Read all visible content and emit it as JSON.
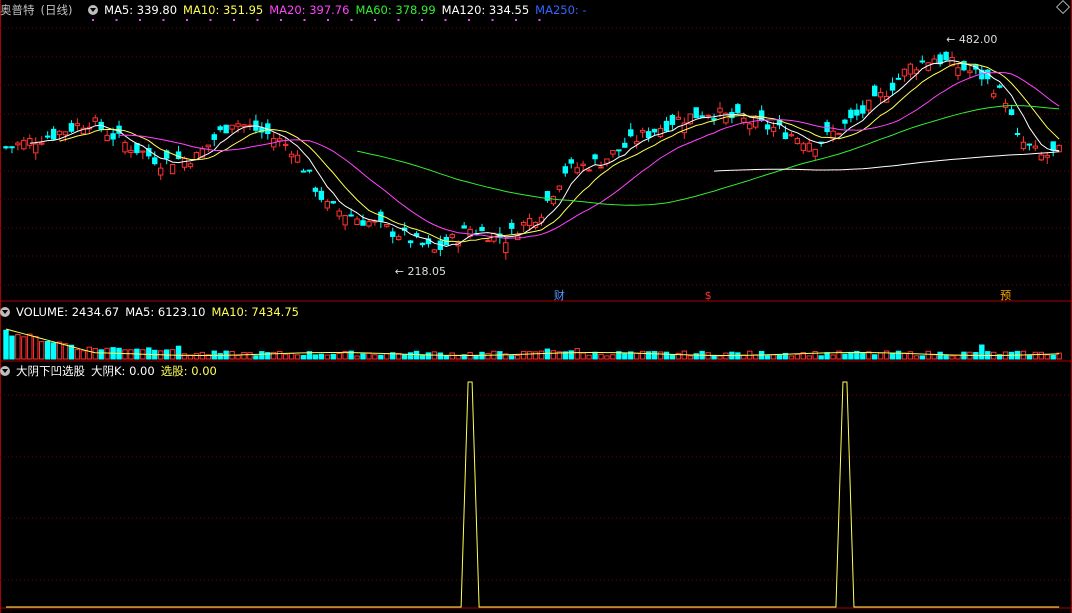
{
  "stock": {
    "name": "奥普特",
    "period": "(日线)"
  },
  "ma_header": [
    {
      "label": "MA5: ",
      "value": "339.80",
      "color": "#ffffff"
    },
    {
      "label": "MA10: ",
      "value": "351.95",
      "color": "#ffff55"
    },
    {
      "label": "MA20: ",
      "value": "397.76",
      "color": "#ff44ff"
    },
    {
      "label": "MA60: ",
      "value": "378.99",
      "color": "#33ee33"
    },
    {
      "label": "MA120: ",
      "value": "334.55",
      "color": "#ffffff"
    },
    {
      "label": "MA250: ",
      "value": "-",
      "color": "#3366ff"
    }
  ],
  "vol_header": [
    {
      "label": "VOLUME: ",
      "value": "2434.67",
      "color": "#ffffff"
    },
    {
      "label": "MA5: ",
      "value": "6123.10",
      "color": "#ffffff"
    },
    {
      "label": "MA10: ",
      "value": "7434.75",
      "color": "#ffff55"
    }
  ],
  "ind_header": {
    "name": "大阴下凹选股",
    "items": [
      {
        "label": "大阴K: ",
        "value": "0.00",
        "color": "#ffffff"
      },
      {
        "label": "选股: ",
        "value": "0.00",
        "color": "#ffff55"
      }
    ]
  },
  "markers": {
    "high_label": "482.00",
    "low_label": "218.05",
    "events": [
      {
        "glyph": "财",
        "x_index": 93,
        "color": "#5599ff"
      },
      {
        "glyph": "$",
        "x_index": 118,
        "color": "#ff3333"
      },
      {
        "glyph": "预",
        "x_index": 168,
        "color": "#ffaa00"
      }
    ]
  },
  "colors": {
    "up": "#ff3333",
    "down": "#00ffff",
    "grid": "#7a0000",
    "panel_border": "#aa0000"
  },
  "chart_data": {
    "type": "candlestick",
    "price_range": [
      205,
      500
    ],
    "n_bars": 178,
    "highest": 482.0,
    "lowest": 218.05,
    "indicator_signals": [
      78,
      141
    ]
  }
}
